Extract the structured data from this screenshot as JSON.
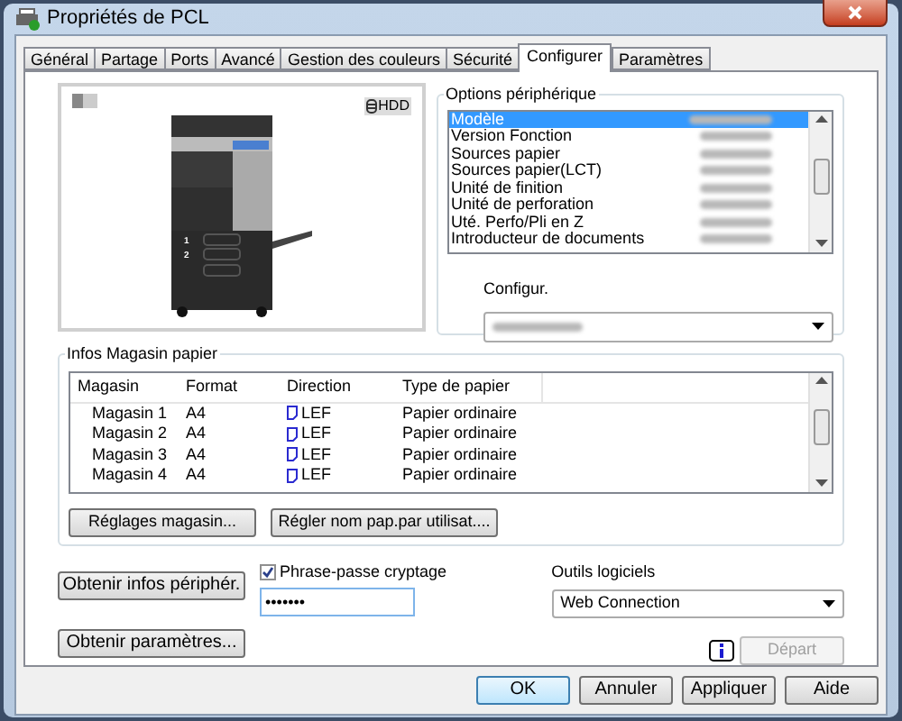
{
  "window": {
    "title": "Propriétés de PCL"
  },
  "tabs": [
    {
      "label": "Général",
      "selected": false
    },
    {
      "label": "Partage",
      "selected": false
    },
    {
      "label": "Ports",
      "selected": false
    },
    {
      "label": "Avancé",
      "selected": false
    },
    {
      "label": "Gestion des couleurs",
      "selected": false
    },
    {
      "label": "Sécurité",
      "selected": false
    },
    {
      "label": "Configurer",
      "selected": true
    },
    {
      "label": "Paramètres",
      "selected": false
    }
  ],
  "preview": {
    "badge": "HDD",
    "tray_labels": [
      "1",
      "2"
    ]
  },
  "device_options": {
    "title": "Options périphérique",
    "items": [
      {
        "label": "Modèle",
        "selected": true
      },
      {
        "label": "Version Fonction",
        "selected": false
      },
      {
        "label": "Sources papier",
        "selected": false
      },
      {
        "label": "Sources papier(LCT)",
        "selected": false
      },
      {
        "label": "Unité de finition",
        "selected": false
      },
      {
        "label": "Unité de perforation",
        "selected": false
      },
      {
        "label": "Uté. Perfo/Pli en Z",
        "selected": false
      },
      {
        "label": "Introducteur de documents",
        "selected": false
      }
    ],
    "config_label": "Configur."
  },
  "trays": {
    "title": "Infos Magasin papier",
    "columns": [
      "Magasin",
      "Format",
      "Direction",
      "Type de papier"
    ],
    "rows": [
      [
        "Magasin 1",
        "A4",
        "LEF",
        "Papier ordinaire"
      ],
      [
        "Magasin 2",
        "A4",
        "LEF",
        "Papier ordinaire"
      ],
      [
        "Magasin 3",
        "A4",
        "LEF",
        "Papier ordinaire"
      ],
      [
        "Magasin 4",
        "A4",
        "LEF",
        "Papier ordinaire"
      ]
    ],
    "buttons": [
      "Réglages magasin...",
      "Régler nom pap.par utilisat...."
    ]
  },
  "get_device_info": "Obtenir infos périphér.",
  "passphrase": {
    "label": "Phrase-passe cryptage",
    "checked": true,
    "value": "•••••••"
  },
  "tools": {
    "label": "Outils logiciels",
    "value": "Web Connection"
  },
  "get_settings": "Obtenir paramètres...",
  "start": {
    "label": "Départ",
    "disabled": true
  },
  "dialog_buttons": [
    {
      "label": "OK",
      "default": true
    },
    {
      "label": "Annuler",
      "default": false
    },
    {
      "label": "Appliquer",
      "default": false
    },
    {
      "label": "Aide",
      "default": false
    }
  ]
}
